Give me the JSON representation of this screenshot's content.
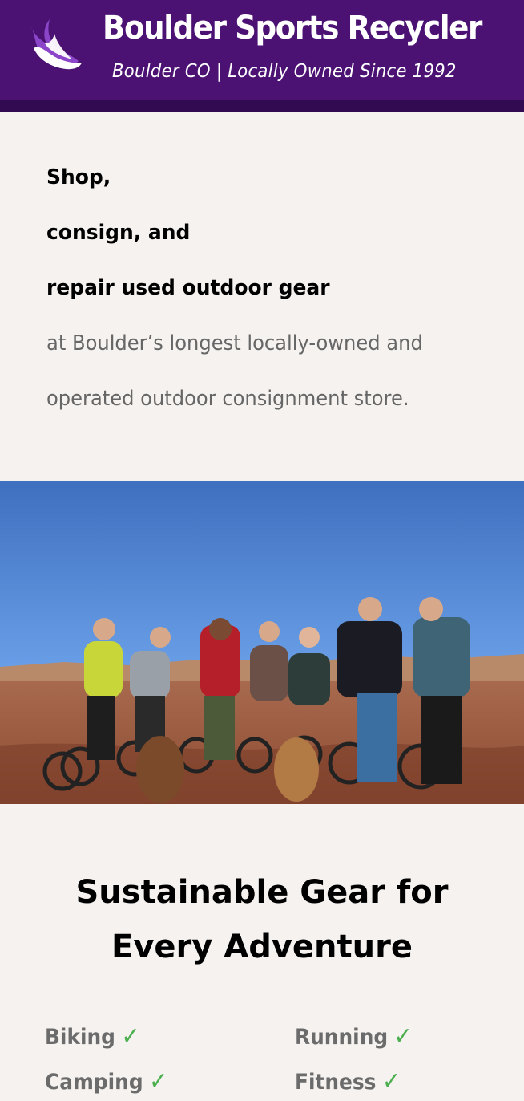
{
  "header": {
    "brand": "Boulder Sports Recycler",
    "tagline": "Boulder CO | Locally Owned Since 1992",
    "logo_icon": "flame-logo-icon",
    "colors": {
      "background": "#4b1273",
      "band": "#320a52",
      "logo_light": "#ffffff",
      "logo_accent": "#8a45c8"
    }
  },
  "intro": {
    "line1": "Shop,",
    "line2": "consign, and",
    "line3": "repair used outdoor gear",
    "line4": "at Boulder’s longest locally-owned and",
    "line5": "operated outdoor consignment store."
  },
  "section": {
    "title_line1": "Sustainable Gear for",
    "title_line2": "Every Adventure"
  },
  "activities": [
    {
      "label": "Biking",
      "check": "✓"
    },
    {
      "label": "Running",
      "check": "✓"
    },
    {
      "label": "Camping",
      "check": "✓"
    },
    {
      "label": "Fitness",
      "check": "✓"
    }
  ],
  "colors": {
    "page_bg": "#f5f2ef",
    "check": "#4caf50",
    "muted_text": "#666666"
  }
}
